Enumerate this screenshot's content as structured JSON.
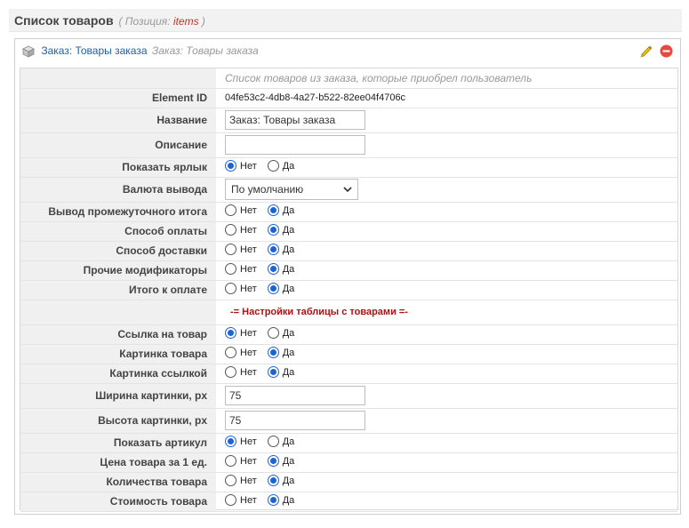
{
  "header": {
    "title": "Список товаров",
    "position_label": "( Позиция:",
    "position_value": "items",
    "position_close": ")"
  },
  "panel": {
    "title": "Заказ: Товары заказа",
    "subtitle": "Заказ: Товары заказа"
  },
  "form": {
    "description": "Список товаров из заказа, которые приобрел пользователь",
    "element_id_label": "Element ID",
    "element_id_value": "04fe53c2-4db8-4a27-b522-82ee04f4706c",
    "name_label": "Название",
    "name_value": "Заказ: Товары заказа",
    "desc_label": "Описание",
    "desc_value": "",
    "currency_label": "Валюта вывода",
    "currency_value": "По умолчанию",
    "section_title": "-= Настройки таблицы с товарами =-",
    "img_width_label": "Ширина картинки, px",
    "img_width_value": "75",
    "img_height_label": "Высота картинки, px",
    "img_height_value": "75",
    "no_label": "Нет",
    "yes_label": "Да",
    "radios": [
      {
        "label": "Показать ярлык",
        "value": "no"
      },
      {
        "label": "Вывод промежуточного итога",
        "value": "yes"
      },
      {
        "label": "Способ оплаты",
        "value": "yes"
      },
      {
        "label": "Способ доставки",
        "value": "yes"
      },
      {
        "label": "Прочие модификаторы",
        "value": "yes"
      },
      {
        "label": "Итого к оплате",
        "value": "yes"
      },
      {
        "label": "Ссылка на товар",
        "value": "no"
      },
      {
        "label": "Картинка товара",
        "value": "yes"
      },
      {
        "label": "Картинка ссылкой",
        "value": "yes"
      },
      {
        "label": "Показать артикул",
        "value": "no"
      },
      {
        "label": "Цена товара за 1 ед.",
        "value": "yes"
      },
      {
        "label": "Количества товара",
        "value": "yes"
      },
      {
        "label": "Стоимость товара",
        "value": "yes"
      }
    ]
  },
  "colors": {
    "accent": "#1a63d8",
    "title_link": "#1f5ea8",
    "section": "#b01010",
    "position_value": "#b03a2e"
  }
}
